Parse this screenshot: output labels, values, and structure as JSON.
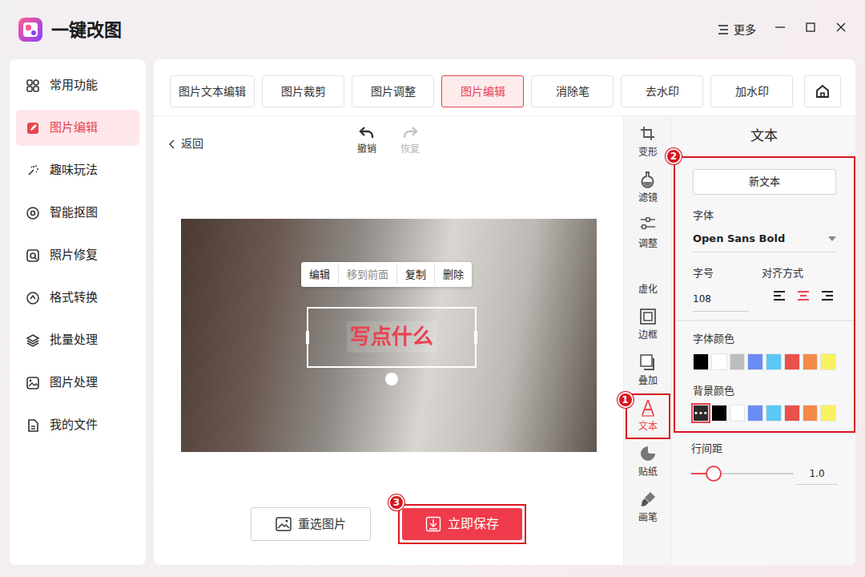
{
  "window": {
    "title": "一键改图",
    "more": "更多"
  },
  "sidebar": {
    "items": [
      {
        "label": "常用功能",
        "selected": false
      },
      {
        "label": "图片编辑",
        "selected": true
      },
      {
        "label": "趣味玩法",
        "selected": false
      },
      {
        "label": "智能抠图",
        "selected": false
      },
      {
        "label": "照片修复",
        "selected": false
      },
      {
        "label": "格式转换",
        "selected": false
      },
      {
        "label": "批量处理",
        "selected": false
      },
      {
        "label": "图片处理",
        "selected": false
      },
      {
        "label": "我的文件",
        "selected": false
      }
    ]
  },
  "tabs": [
    {
      "label": "图片文本编辑",
      "selected": false
    },
    {
      "label": "图片裁剪",
      "selected": false
    },
    {
      "label": "图片调整",
      "selected": false
    },
    {
      "label": "图片编辑",
      "selected": true
    },
    {
      "label": "消除笔",
      "selected": false
    },
    {
      "label": "去水印",
      "selected": false
    },
    {
      "label": "加水印",
      "selected": false
    }
  ],
  "toolbar": {
    "back": "返回",
    "undo": {
      "label": "撤销",
      "disabled": false
    },
    "redo": {
      "label": "恢复",
      "disabled": true
    }
  },
  "canvas": {
    "text": "写点什么",
    "menu": [
      {
        "label": "编辑",
        "disabled": false
      },
      {
        "label": "移到前面",
        "disabled": true
      },
      {
        "label": "复制",
        "disabled": false
      },
      {
        "label": "删除",
        "disabled": false
      }
    ]
  },
  "actions": {
    "reselect": "重选图片",
    "save": "立即保存"
  },
  "tools": [
    {
      "label": "变形",
      "selected": false
    },
    {
      "label": "滤镜",
      "selected": false
    },
    {
      "label": "调整",
      "selected": false
    },
    {
      "label": "虚化",
      "selected": false
    },
    {
      "label": "边框",
      "selected": false
    },
    {
      "label": "叠加",
      "selected": false
    },
    {
      "label": "文本",
      "selected": true
    },
    {
      "label": "贴纸",
      "selected": false
    },
    {
      "label": "画笔",
      "selected": false
    }
  ],
  "panel": {
    "title": "文本",
    "new_text": "新文本",
    "font_label": "字体",
    "font": "Open Sans Bold",
    "size_label": "字号",
    "size": "108",
    "align_label": "对齐方式",
    "align": [
      {
        "kind": "left",
        "selected": false
      },
      {
        "kind": "center",
        "selected": true
      },
      {
        "kind": "right",
        "selected": false
      }
    ],
    "font_color_label": "字体颜色",
    "font_colors": [
      {
        "color": "#000000"
      },
      {
        "color": "#ffffff"
      },
      {
        "color": "#bdbdbd"
      },
      {
        "color": "#6b8cf5"
      },
      {
        "color": "#5bc8f5"
      },
      {
        "color": "#e8524a"
      },
      {
        "color": "#f5894a"
      },
      {
        "color": "#f9f25e"
      }
    ],
    "bg_color_label": "背景颜色",
    "bg_colors": [
      {
        "kind": "custom",
        "label": "•••",
        "color": "#2b2b2b",
        "selected": true
      },
      {
        "kind": "plain",
        "color": "#000000",
        "selected": false
      },
      {
        "kind": "plain",
        "color": "#ffffff",
        "selected": false
      },
      {
        "kind": "plain",
        "color": "#6b8cf5",
        "selected": false
      },
      {
        "kind": "plain",
        "color": "#5bc8f5",
        "selected": false
      },
      {
        "kind": "plain",
        "color": "#e8524a",
        "selected": false
      },
      {
        "kind": "plain",
        "color": "#f5894a",
        "selected": false
      },
      {
        "kind": "plain",
        "color": "#f9f25e",
        "selected": false
      }
    ],
    "line_spacing": {
      "label": "行间距",
      "level": 0.22,
      "reading": "1.0"
    }
  },
  "annotations": [
    {
      "number": "1"
    },
    {
      "number": "2"
    },
    {
      "number": "3"
    }
  ]
}
